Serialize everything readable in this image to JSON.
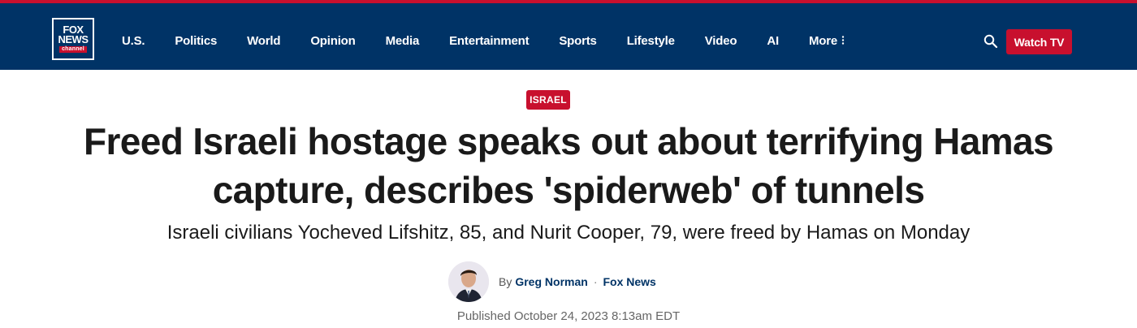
{
  "brand": {
    "logo_line1": "FOX",
    "logo_line2": "NEWS",
    "logo_line3": "channel"
  },
  "nav": {
    "items": [
      "U.S.",
      "Politics",
      "World",
      "Opinion",
      "Media",
      "Entertainment",
      "Sports",
      "Lifestyle",
      "Video",
      "AI"
    ],
    "more_label": "More",
    "more_icon": "kebab-icon",
    "search_icon": "search-icon",
    "watch_label": "Watch TV"
  },
  "colors": {
    "nav_bg": "#003366",
    "accent_red": "#c8102e"
  },
  "article": {
    "tag": "ISRAEL",
    "headline_line1": "Freed Israeli hostage speaks out about terrifying Hamas",
    "headline_line2": "capture, describes 'spiderweb' of tunnels",
    "subhead": "Israeli civilians Yocheved Lifshitz, 85, and Nurit Cooper, 79, were freed by Hamas on Monday",
    "by_prefix": "By",
    "author": "Greg Norman",
    "separator": "·",
    "outlet": "Fox News",
    "published": "Published October 24, 2023 8:13am EDT"
  }
}
